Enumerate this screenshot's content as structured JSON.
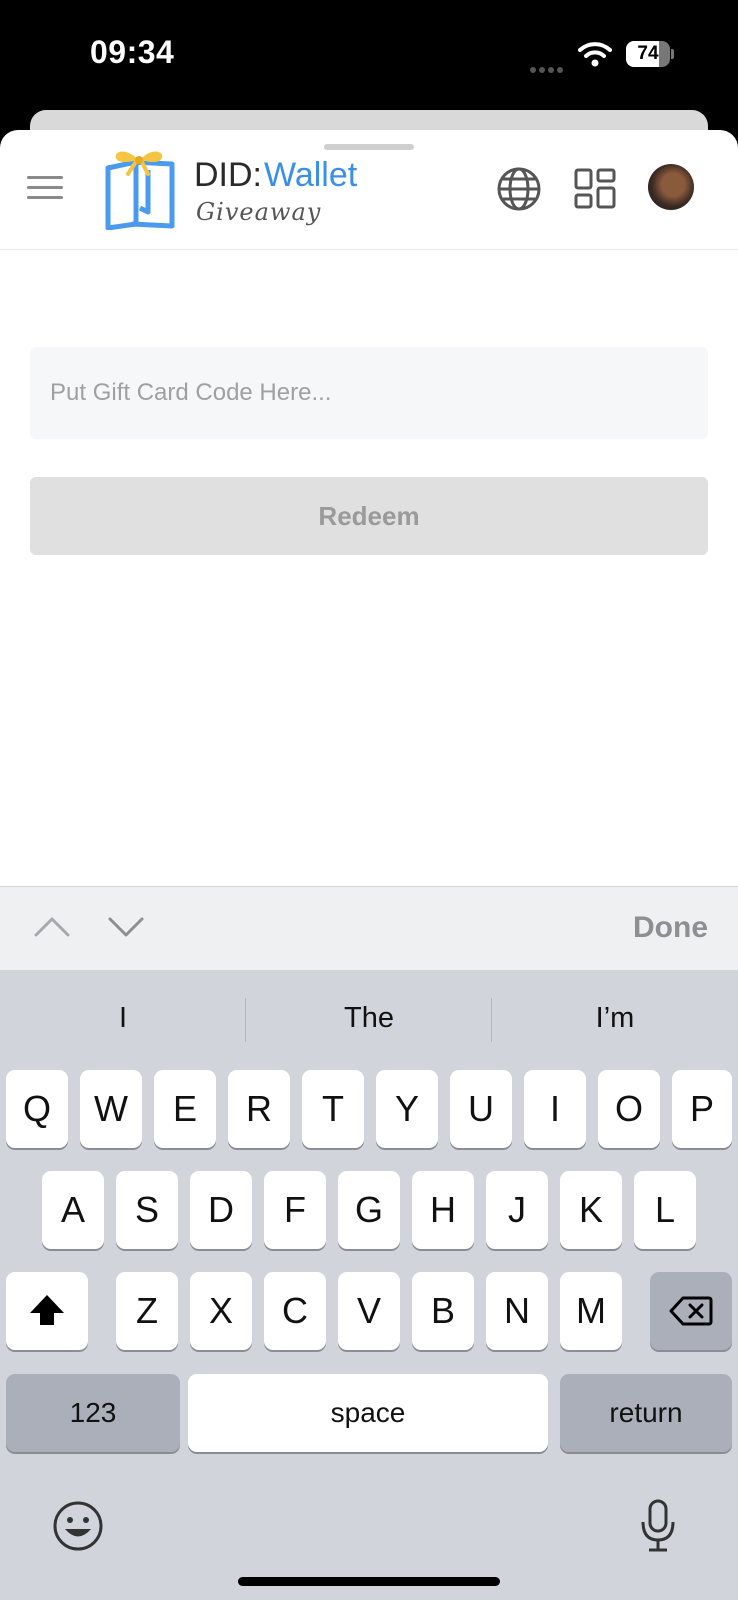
{
  "status_bar": {
    "time": "09:34",
    "battery": "74",
    "battery_level": 0.74
  },
  "header": {
    "menu_icon": "menu-icon",
    "brand_prefix": "DID:",
    "brand_name": "Wallet",
    "brand_subtitle": "Giveaway",
    "globe_icon": "globe-icon",
    "apps_icon": "apps-icon",
    "accent_color": "#3b8fe8"
  },
  "form": {
    "code_placeholder": "Put Gift Card Code Here...",
    "code_value": "",
    "redeem_label": "Redeem"
  },
  "accessory": {
    "done_label": "Done"
  },
  "keyboard": {
    "suggestions": [
      "I",
      "The",
      "I’m"
    ],
    "row1": [
      "Q",
      "W",
      "E",
      "R",
      "T",
      "Y",
      "U",
      "I",
      "O",
      "P"
    ],
    "row2": [
      "A",
      "S",
      "D",
      "F",
      "G",
      "H",
      "J",
      "K",
      "L"
    ],
    "row3": [
      "Z",
      "X",
      "C",
      "V",
      "B",
      "N",
      "M"
    ],
    "numbers_label": "123",
    "space_label": "space",
    "return_label": "return"
  }
}
